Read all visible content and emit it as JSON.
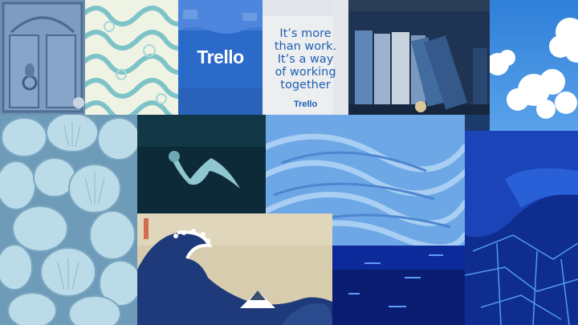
{
  "board_tile": {
    "wordmark": "Trello"
  },
  "quote_card": {
    "lines": [
      "It’s more",
      "than work.",
      "It’s a way",
      "of working",
      "together"
    ],
    "logo": "Trello"
  },
  "colors": {
    "trello_blue": "#2c6ac9",
    "card_text": "#1f5fb3",
    "card_bg": "#eef0f2"
  }
}
